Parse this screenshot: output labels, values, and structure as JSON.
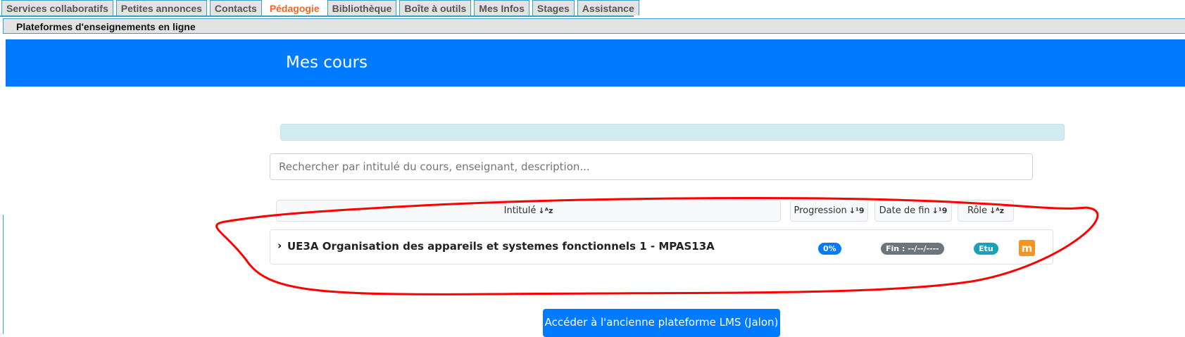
{
  "tabs": [
    {
      "label": "Services collaboratifs"
    },
    {
      "label": "Petites annonces"
    },
    {
      "label": "Contacts"
    },
    {
      "label": "Pédagogie"
    },
    {
      "label": "Bibliothèque"
    },
    {
      "label": "Boîte à outils"
    },
    {
      "label": "Mes Infos"
    },
    {
      "label": "Stages"
    },
    {
      "label": "Assistance"
    }
  ],
  "active_tab": "Pédagogie",
  "subnav": {
    "item": "Plateformes d'enseignements en ligne"
  },
  "banner": {
    "title": "Mes cours"
  },
  "search": {
    "placeholder": "Rechercher par intitulé du cours, enseignant, description..."
  },
  "headers": {
    "intitule": "Intitulé",
    "progression": "Progression",
    "date_fin": "Date de fin",
    "role": "Rôle",
    "sort_az": "↓ᴬz",
    "sort_19": "↓¹9"
  },
  "course": {
    "title": "UE3A Organisation des appareils et systemes fonctionnels 1 - MPAS13A",
    "progress": "0%",
    "end": "Fin : --/--/----",
    "role": "Etu",
    "platform_icon": "m"
  },
  "colors": {
    "primary": "#007bff",
    "secondary": "#6c757d",
    "info": "#17a2b8",
    "moodle": "#f7931e",
    "accent": "#f26522"
  },
  "old_platform_button": "Accéder à l'ancienne plateforme LMS (Jalon)"
}
